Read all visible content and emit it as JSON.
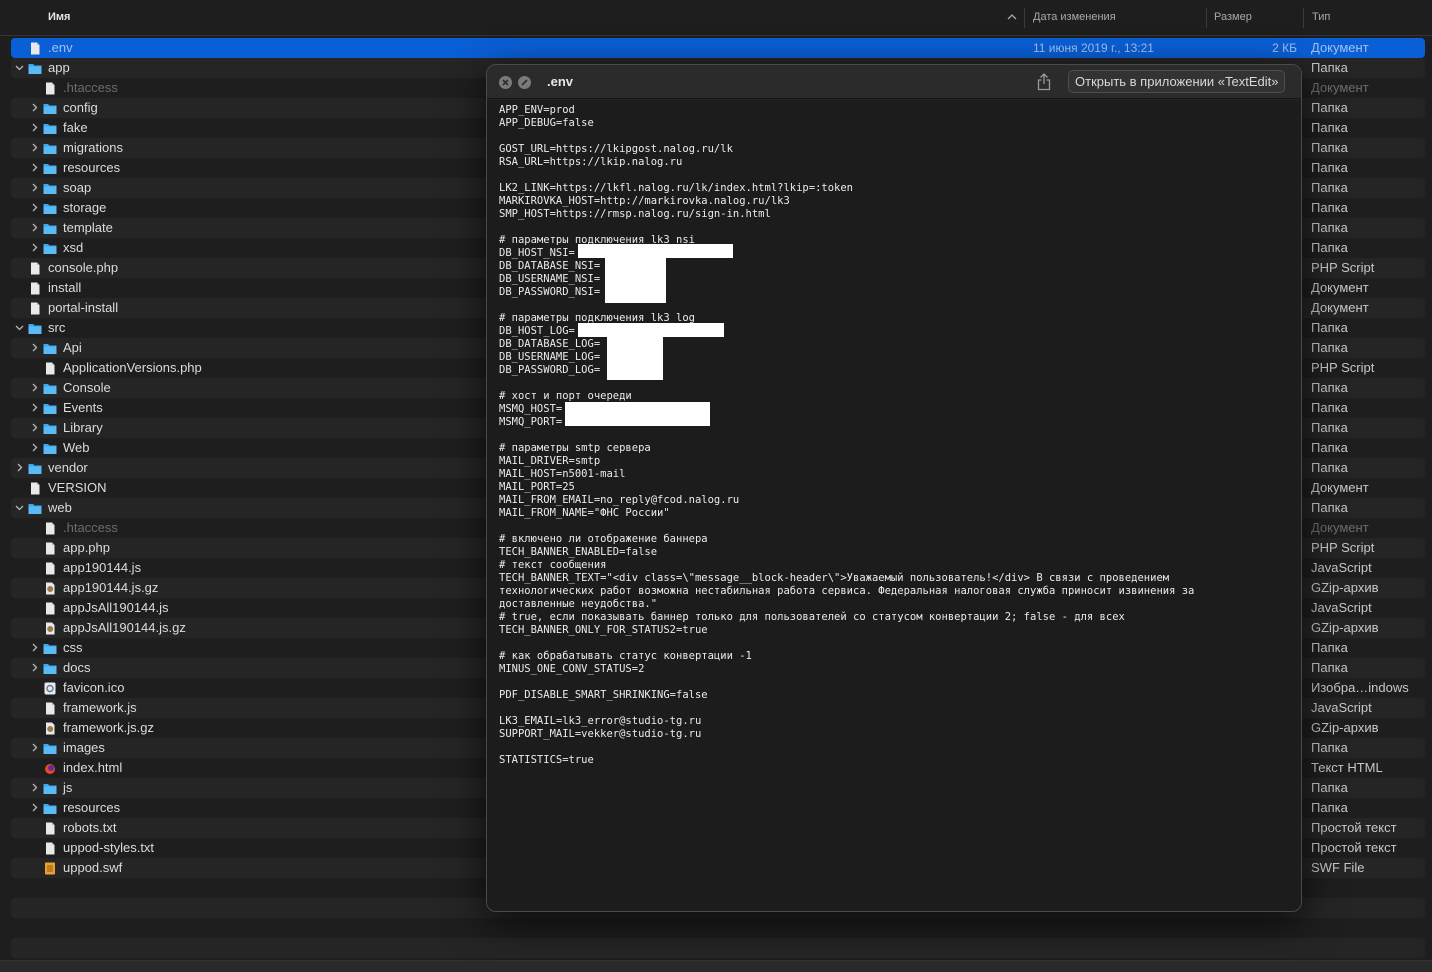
{
  "finder": {
    "columns": {
      "name": "Имя",
      "date": "Дата изменения",
      "size": "Размер",
      "type": "Тип"
    },
    "rows": [
      {
        "indent": 0,
        "chevron": "",
        "icon": "doc",
        "name": ".env",
        "date": "11 июня 2019 г., 13:21",
        "size": "2 КБ",
        "type": "Документ",
        "selected": true,
        "dim": false
      },
      {
        "indent": 0,
        "chevron": "down",
        "icon": "folder",
        "name": "app",
        "type": "Папка"
      },
      {
        "indent": 1,
        "chevron": "",
        "icon": "doc",
        "name": ".htaccess",
        "type": "Документ",
        "dim": true
      },
      {
        "indent": 1,
        "chevron": "right",
        "icon": "folder",
        "name": "config",
        "type": "Папка"
      },
      {
        "indent": 1,
        "chevron": "right",
        "icon": "folder",
        "name": "fake",
        "type": "Папка"
      },
      {
        "indent": 1,
        "chevron": "right",
        "icon": "folder",
        "name": "migrations",
        "type": "Папка"
      },
      {
        "indent": 1,
        "chevron": "right",
        "icon": "folder",
        "name": "resources",
        "type": "Папка"
      },
      {
        "indent": 1,
        "chevron": "right",
        "icon": "folder",
        "name": "soap",
        "type": "Папка"
      },
      {
        "indent": 1,
        "chevron": "right",
        "icon": "folder",
        "name": "storage",
        "type": "Папка"
      },
      {
        "indent": 1,
        "chevron": "right",
        "icon": "folder",
        "name": "template",
        "type": "Папка"
      },
      {
        "indent": 1,
        "chevron": "right",
        "icon": "folder",
        "name": "xsd",
        "type": "Папка"
      },
      {
        "indent": 0,
        "chevron": "",
        "icon": "doc",
        "name": "console.php",
        "type": "PHP Script"
      },
      {
        "indent": 0,
        "chevron": "",
        "icon": "doc",
        "name": "install",
        "type": "Документ"
      },
      {
        "indent": 0,
        "chevron": "",
        "icon": "doc",
        "name": "portal-install",
        "type": "Документ"
      },
      {
        "indent": 0,
        "chevron": "down",
        "icon": "folder",
        "name": "src",
        "type": "Папка"
      },
      {
        "indent": 1,
        "chevron": "right",
        "icon": "folder",
        "name": "Api",
        "type": "Папка"
      },
      {
        "indent": 1,
        "chevron": "",
        "icon": "doc",
        "name": "ApplicationVersions.php",
        "type": "PHP Script"
      },
      {
        "indent": 1,
        "chevron": "right",
        "icon": "folder",
        "name": "Console",
        "type": "Папка"
      },
      {
        "indent": 1,
        "chevron": "right",
        "icon": "folder",
        "name": "Events",
        "type": "Папка"
      },
      {
        "indent": 1,
        "chevron": "right",
        "icon": "folder",
        "name": "Library",
        "type": "Папка"
      },
      {
        "indent": 1,
        "chevron": "right",
        "icon": "folder",
        "name": "Web",
        "type": "Папка"
      },
      {
        "indent": 0,
        "chevron": "right",
        "icon": "folder",
        "name": "vendor",
        "type": "Папка"
      },
      {
        "indent": 0,
        "chevron": "",
        "icon": "doc",
        "name": "VERSION",
        "type": "Документ"
      },
      {
        "indent": 0,
        "chevron": "down",
        "icon": "folder",
        "name": "web",
        "type": "Папка"
      },
      {
        "indent": 1,
        "chevron": "",
        "icon": "doc",
        "name": ".htaccess",
        "type": "Документ",
        "dim": true
      },
      {
        "indent": 1,
        "chevron": "",
        "icon": "doc",
        "name": "app.php",
        "type": "PHP Script"
      },
      {
        "indent": 1,
        "chevron": "",
        "icon": "doc",
        "name": "app190144.js",
        "type": "JavaScript"
      },
      {
        "indent": 1,
        "chevron": "",
        "icon": "gz",
        "name": "app190144.js.gz",
        "type": "GZip-архив"
      },
      {
        "indent": 1,
        "chevron": "",
        "icon": "doc",
        "name": "appJsAll190144.js",
        "type": "JavaScript"
      },
      {
        "indent": 1,
        "chevron": "",
        "icon": "gz",
        "name": "appJsAll190144.js.gz",
        "type": "GZip-архив"
      },
      {
        "indent": 1,
        "chevron": "right",
        "icon": "folder",
        "name": "css",
        "type": "Папка"
      },
      {
        "indent": 1,
        "chevron": "right",
        "icon": "folder",
        "name": "docs",
        "type": "Папка"
      },
      {
        "indent": 1,
        "chevron": "",
        "icon": "ico",
        "name": "favicon.ico",
        "type": "Изобра…indows"
      },
      {
        "indent": 1,
        "chevron": "",
        "icon": "doc",
        "name": "framework.js",
        "type": "JavaScript"
      },
      {
        "indent": 1,
        "chevron": "",
        "icon": "gz",
        "name": "framework.js.gz",
        "type": "GZip-архив"
      },
      {
        "indent": 1,
        "chevron": "right",
        "icon": "folder",
        "name": "images",
        "type": "Папка"
      },
      {
        "indent": 1,
        "chevron": "",
        "icon": "html",
        "name": "index.html",
        "type": "Текст HTML"
      },
      {
        "indent": 1,
        "chevron": "right",
        "icon": "folder",
        "name": "js",
        "type": "Папка"
      },
      {
        "indent": 1,
        "chevron": "right",
        "icon": "folder",
        "name": "resources",
        "type": "Папка"
      },
      {
        "indent": 1,
        "chevron": "",
        "icon": "doc",
        "name": "robots.txt",
        "type": "Простой текст"
      },
      {
        "indent": 1,
        "chevron": "",
        "icon": "doc",
        "name": "uppod-styles.txt",
        "type": "Простой текст"
      },
      {
        "indent": 1,
        "chevron": "",
        "icon": "swf",
        "name": "uppod.swf",
        "type": "SWF File"
      }
    ]
  },
  "quicklook": {
    "title": ".env",
    "open_button": "Открыть в приложении «TextEdit»",
    "lines": [
      "APP_ENV=prod",
      "APP_DEBUG=false",
      "",
      "GOST_URL=https://lkipgost.nalog.ru/lk",
      "RSA_URL=https://lkip.nalog.ru",
      "",
      "LK2_LINK=https://lkfl.nalog.ru/lk/index.html?lkip=:token",
      "MARKIROVKA_HOST=http://markirovka.nalog.ru/lk3",
      "SMP_HOST=https://rmsp.nalog.ru/sign-in.html",
      "",
      "# параметры подключения lk3_nsi",
      "DB_HOST_NSI=",
      "DB_DATABASE_NSI=",
      "DB_USERNAME_NSI=",
      "DB_PASSWORD_NSI=",
      "",
      "# параметры подключения lk3_log",
      "DB_HOST_LOG=",
      "DB_DATABASE_LOG=",
      "DB_USERNAME_LOG=",
      "DB_PASSWORD_LOG=",
      "",
      "# хост и порт очереди",
      "MSMQ_HOST=",
      "MSMQ_PORT=",
      "",
      "# параметры smtp сервера",
      "MAIL_DRIVER=smtp",
      "MAIL_HOST=n5001-mail",
      "MAIL_PORT=25",
      "MAIL_FROM_EMAIL=no_reply@fcod.nalog.ru",
      "MAIL_FROM_NAME=\"ФНС России\"",
      "",
      "# включено ли отображение баннера",
      "TECH_BANNER_ENABLED=false",
      "# текст сообщения",
      "TECH_BANNER_TEXT=\"<div class=\\\"message__block-header\\\">Уважаемый пользователь!</div> В связи с проведением",
      "технологических работ возможна нестабильная работа сервиса. Федеральная налоговая служба приносит извинения за",
      "доставленные неудобства.\"",
      "# true, если показывать баннер только для пользователей со статусом конвертации 2; false - для всех",
      "TECH_BANNER_ONLY_FOR_STATUS2=true",
      "",
      "# как обрабатывать статус конвертации -1",
      "MINUS_ONE_CONV_STATUS=2",
      "",
      "PDF_DISABLE_SMART_SHRINKING=false",
      "",
      "LK3_EMAIL=lk3_error@studio-tg.ru",
      "SUPPORT_MAIL=vekker@studio-tg.ru",
      "",
      "STATISTICS=true"
    ]
  },
  "colors": {
    "selection": "#0a5fd6",
    "folder": "#3aa8f0",
    "background": "#1e1e1e"
  }
}
